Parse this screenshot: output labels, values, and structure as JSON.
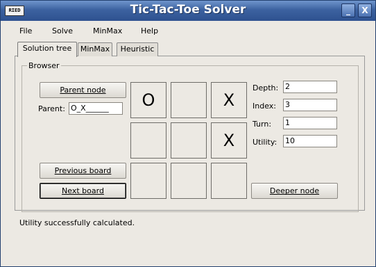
{
  "window": {
    "title": "Tic-Tac-Toe Solver",
    "app_icon_text": "RIED",
    "minimize": "_",
    "close": "X"
  },
  "menu": [
    "File",
    "Solve",
    "MinMax",
    "Help"
  ],
  "tabs": [
    {
      "label": "Solution tree",
      "active": true
    },
    {
      "label": "MinMax",
      "active": false
    },
    {
      "label": "Heuristic",
      "active": false
    }
  ],
  "browser": {
    "legend": "Browser",
    "parent_button": "Parent node",
    "parent_label": "Parent:",
    "parent_value": "O_X______",
    "previous_button": "Previous board",
    "next_button": "Next board",
    "deeper_button": "Deeper node"
  },
  "board": [
    "O",
    "",
    "X",
    "",
    "",
    "X",
    "",
    "",
    ""
  ],
  "info": {
    "depth_label": "Depth:",
    "depth": "2",
    "index_label": "Index:",
    "index": "3",
    "turn_label": "Turn:",
    "turn": "1",
    "utility_label": "Utility:",
    "utility": "10"
  },
  "status": "Utility successfully calculated."
}
